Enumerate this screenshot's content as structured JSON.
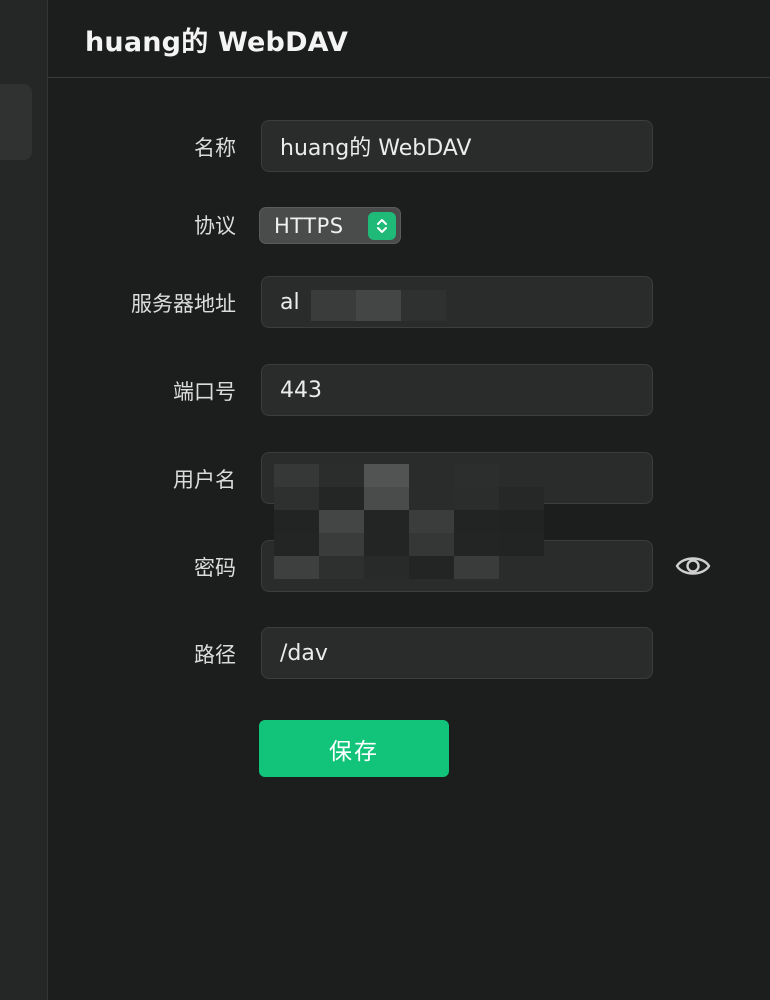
{
  "header": {
    "title": "huang的 WebDAV"
  },
  "form": {
    "name": {
      "label": "名称",
      "value": "huang的 WebDAV"
    },
    "protocol": {
      "label": "协议",
      "value": "HTTPS"
    },
    "server": {
      "label": "服务器地址",
      "value": "al"
    },
    "port": {
      "label": "端口号",
      "value": "443"
    },
    "username": {
      "label": "用户名",
      "value": ""
    },
    "password": {
      "label": "密码",
      "value": ""
    },
    "path": {
      "label": "路径",
      "value": "/dav"
    }
  },
  "actions": {
    "save_label": "保存"
  },
  "icons": {
    "select": "chevron-up-down-icon",
    "password_toggle": "eye-icon"
  },
  "colors": {
    "background": "#1c1d1d",
    "sidebar": "#252626",
    "input_bg": "#2a2b2b",
    "accent": "#11c47a",
    "select_accent": "#1fb978"
  }
}
